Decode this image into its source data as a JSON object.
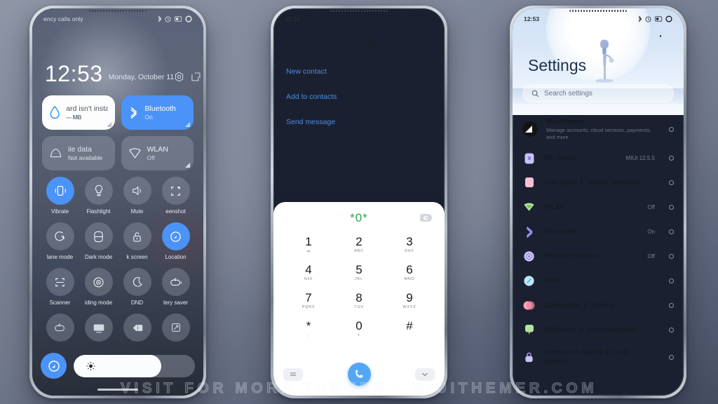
{
  "watermark": "VISIT FOR MORE THEMES - MIUITHEMER.COM",
  "colors": {
    "accent_blue": "#4b93f7",
    "dial_green": "#2aa855",
    "link_blue": "#4a8ee0",
    "call_blue": "#55a7f5"
  },
  "phone1": {
    "name": "lock-screen-control-center",
    "statusbar": {
      "carrier": "ency calls only",
      "icons": [
        "bluetooth-icon",
        "alarm-icon",
        "battery-icon",
        "circle-icon"
      ]
    },
    "clock": {
      "time": "12:53",
      "date": "Monday, October 11",
      "actions": [
        "camera-icon",
        "edit-icon"
      ]
    },
    "big_tiles": [
      {
        "title": "ard isn't insta",
        "sub": "--- MB",
        "icon": "data-drop-icon",
        "state": "white"
      },
      {
        "title": "Bluetooth",
        "sub": "On",
        "icon": "bluetooth-icon",
        "state": "on"
      },
      {
        "title": "ile data",
        "sub": "Not available",
        "icon": "mobile-data-icon",
        "state": "dim"
      },
      {
        "title": "WLAN",
        "sub": "Off",
        "icon": "wlan-icon",
        "state": "off"
      }
    ],
    "tiles": [
      {
        "label": "Vibrate",
        "icon": "vibrate-icon",
        "on": true
      },
      {
        "label": "Flashlight",
        "icon": "flashlight-icon",
        "on": false
      },
      {
        "label": "Mute",
        "icon": "mute-icon",
        "on": false
      },
      {
        "label": "eenshot",
        "icon": "screenshot-icon",
        "on": false
      },
      {
        "label": "lane mode",
        "icon": "airplane-icon",
        "on": false
      },
      {
        "label": "Dark mode",
        "icon": "dark-mode-icon",
        "on": false
      },
      {
        "label": "k screen",
        "icon": "lock-screen-icon",
        "on": false
      },
      {
        "label": "Location",
        "icon": "location-icon",
        "on": true
      },
      {
        "label": "Scanner",
        "icon": "scanner-icon",
        "on": false
      },
      {
        "label": "iding mode",
        "icon": "reading-mode-icon",
        "on": false
      },
      {
        "label": "DND",
        "icon": "dnd-moon-icon",
        "on": false
      },
      {
        "label": "tery saver",
        "icon": "battery-saver-icon",
        "on": false
      },
      {
        "label": "",
        "icon": "battery-saver-icon",
        "on": false
      },
      {
        "label": "",
        "icon": "cast-icon",
        "on": false
      },
      {
        "label": "",
        "icon": "contrast-icon",
        "on": false
      },
      {
        "label": "",
        "icon": "sync-rotate-icon",
        "on": false
      }
    ],
    "bottom": {
      "button_icon": "location-icon",
      "brightness_icon": "brightness-sun-icon",
      "brightness_percent": 72
    }
  },
  "phone2": {
    "name": "recents-dialer-screen",
    "statusbar": {
      "time": "12:53",
      "icons": [
        "bluetooth-icon",
        "alarm-icon",
        "battery-icon",
        "circle-icon"
      ]
    },
    "nav": {
      "back_icon": "arrow-left-icon",
      "title": "Recents"
    },
    "links": [
      "New contact",
      "Add to contacts",
      "Send message"
    ],
    "dialer": {
      "number": "*0*",
      "backspace_icon": "backspace-icon",
      "keys": [
        {
          "digit": "1",
          "sub": "∞"
        },
        {
          "digit": "2",
          "sub": "ABC"
        },
        {
          "digit": "3",
          "sub": "DEF"
        },
        {
          "digit": "4",
          "sub": "GHI"
        },
        {
          "digit": "5",
          "sub": "JKL"
        },
        {
          "digit": "6",
          "sub": "MNO"
        },
        {
          "digit": "7",
          "sub": "PQRS"
        },
        {
          "digit": "8",
          "sub": "TUV"
        },
        {
          "digit": "9",
          "sub": "WXYZ"
        },
        {
          "digit": "*",
          "sub": ","
        },
        {
          "digit": "0",
          "sub": "+"
        },
        {
          "digit": "#",
          "sub": ""
        }
      ],
      "actions": {
        "left_icon": "keypad-menu-icon",
        "call_icon": "phone-call-icon",
        "right_icon": "chevron-down-icon"
      }
    }
  },
  "phone3": {
    "name": "settings-screen",
    "statusbar": {
      "time": "12:53",
      "icons": [
        "bluetooth-icon",
        "alarm-icon",
        "battery-icon",
        "circle-icon"
      ]
    },
    "title": "Settings",
    "search": {
      "icon": "search-icon",
      "placeholder": "Search settings"
    },
    "account": {
      "label": "Miuithemer",
      "sub": "Manage accounts, cloud services, payments, and more",
      "avatar": "user-avatar"
    },
    "rows": [
      {
        "label": "My device",
        "value": "MIUI 12.5.5",
        "icon": "device-icon",
        "color": "#b0a8f0"
      },
      {
        "label": "SIM cards & mobile networks",
        "value": "",
        "icon": "sim-card-icon",
        "color": "#f2a0b8"
      },
      {
        "label": "WLAN",
        "value": "Off",
        "icon": "wlan-icon",
        "color": "#8fd67e"
      },
      {
        "label": "Bluetooth",
        "value": "On",
        "icon": "bluetooth-icon",
        "color": "#9a8ff0"
      },
      {
        "label": "Portable hotspot",
        "value": "Off",
        "icon": "hotspot-icon",
        "color": "#9a8ff0"
      },
      {
        "label": "VPN",
        "value": "",
        "icon": "vpn-icon",
        "color": "#6fc5ef"
      },
      {
        "label": "Connection & sharing",
        "value": "",
        "icon": "sharing-icon",
        "color": "#f58ba6"
      },
      {
        "label": "Wallpaper & personalization",
        "value": "",
        "icon": "wallpaper-icon",
        "color": "#8fd67e"
      },
      {
        "label": "Always-on display & Lock screen",
        "value": "",
        "icon": "aod-lock-icon",
        "color": "#9a8ff0"
      }
    ]
  }
}
